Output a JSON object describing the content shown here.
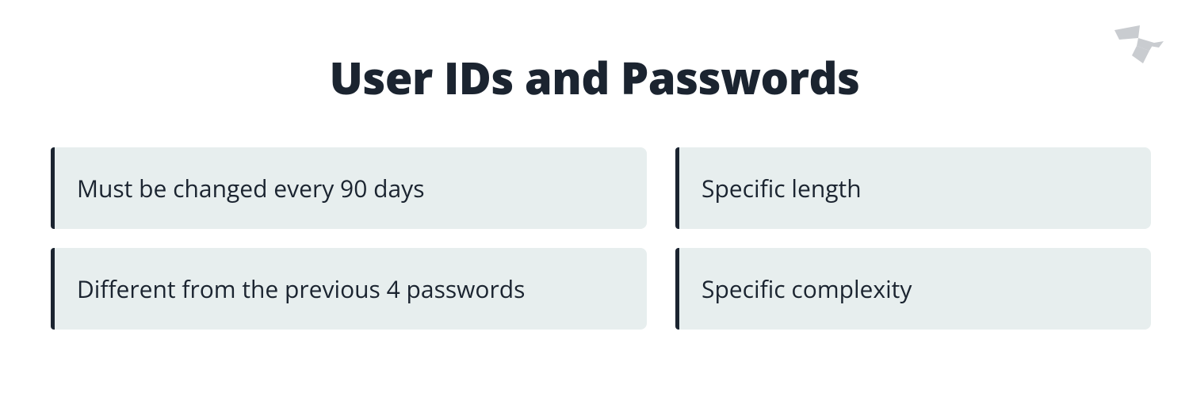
{
  "title": "User IDs and Passwords",
  "cards": {
    "c0": "Must be changed every 90 days",
    "c1": "Specific length",
    "c2": "Different from the previous 4 passwords",
    "c3": "Specific complexity"
  }
}
